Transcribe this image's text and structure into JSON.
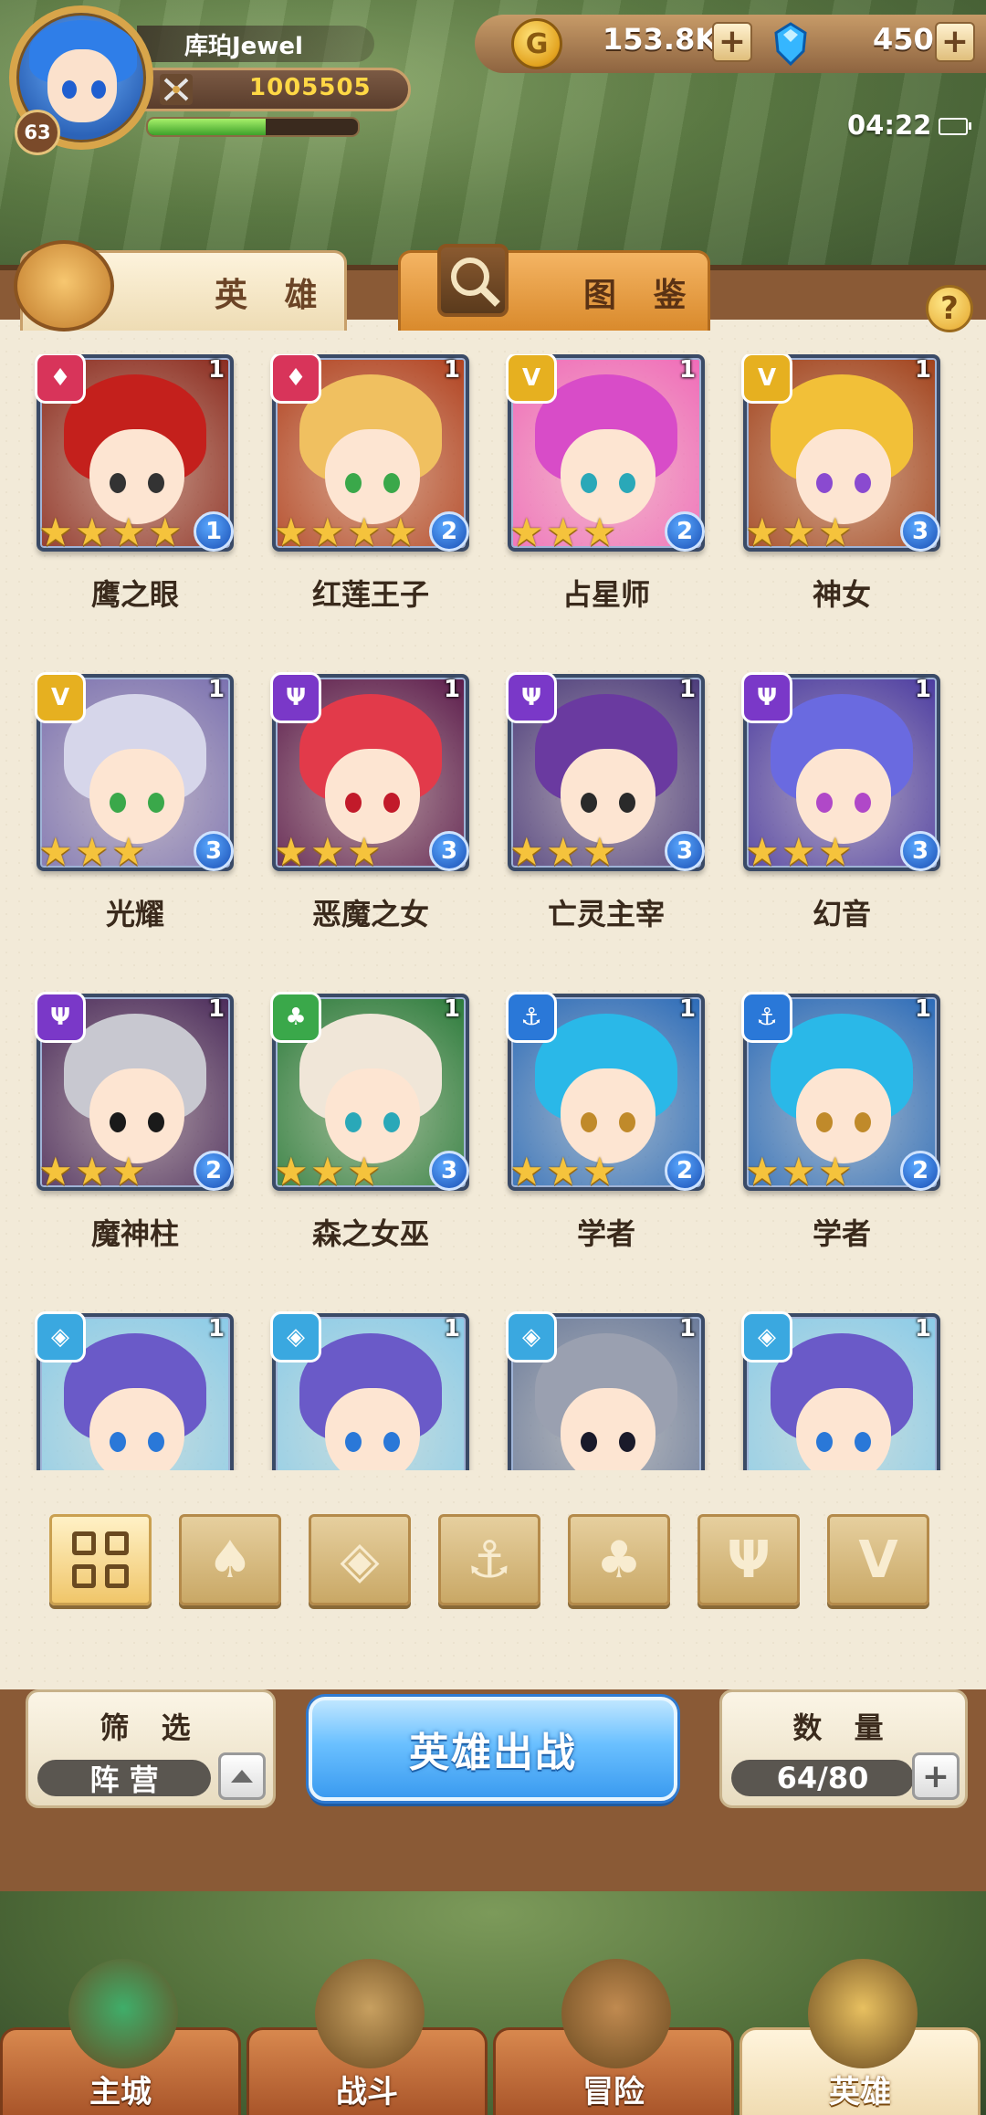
{
  "player": {
    "name": "库珀Jewel",
    "level": "63",
    "power": "1005505",
    "exp_fraction": 0.56
  },
  "resources": {
    "gold": "153.8K",
    "gems": "450",
    "add_symbol": "+"
  },
  "status": {
    "time": "04:22"
  },
  "tabs": {
    "heroes": "英 雄",
    "codex": "图 鉴",
    "help": "?"
  },
  "heroes": [
    {
      "name": "鹰之眼",
      "stars": 4,
      "level": "1",
      "corner": "1",
      "faction": "fire",
      "faction_color": "#d8345a",
      "hair": "#c4201c",
      "eye": "#333333",
      "bg": "#8a2a1e"
    },
    {
      "name": "红莲王子",
      "stars": 4,
      "level": "2",
      "corner": "1",
      "faction": "fire",
      "faction_color": "#d8345a",
      "hair": "#f0c060",
      "eye": "#3aa84a",
      "bg": "#b0401e"
    },
    {
      "name": "占星师",
      "stars": 3,
      "level": "2",
      "corner": "1",
      "faction": "light",
      "faction_color": "#e6b020",
      "hair": "#d84cc8",
      "eye": "#2aa8b8",
      "bg": "#f06ab8"
    },
    {
      "name": "神女",
      "stars": 3,
      "level": "3",
      "corner": "1",
      "faction": "light",
      "faction_color": "#e6b020",
      "hair": "#f2c038",
      "eye": "#8a4ad0",
      "bg": "#a0401a"
    },
    {
      "name": "光耀",
      "stars": 3,
      "level": "3",
      "corner": "1",
      "faction": "light",
      "faction_color": "#e6b020",
      "hair": "#d6d6ea",
      "eye": "#3aa84a",
      "bg": "#7a70b0"
    },
    {
      "name": "恶魔之女",
      "stars": 3,
      "level": "3",
      "corner": "1",
      "faction": "dark",
      "faction_color": "#7a38c8",
      "hair": "#e23a4a",
      "eye": "#c21a2a",
      "bg": "#5a1a4a"
    },
    {
      "name": "亡灵主宰",
      "stars": 3,
      "level": "3",
      "corner": "1",
      "faction": "dark",
      "faction_color": "#7a38c8",
      "hair": "#6a3aa0",
      "eye": "#2a2a2a",
      "bg": "#4a3a7a"
    },
    {
      "name": "幻音",
      "stars": 3,
      "level": "3",
      "corner": "1",
      "faction": "dark",
      "faction_color": "#7a38c8",
      "hair": "#6a6ae0",
      "eye": "#b048c8",
      "bg": "#4a3aa0"
    },
    {
      "name": "魔神柱",
      "stars": 3,
      "level": "2",
      "corner": "1",
      "faction": "dark",
      "faction_color": "#7a38c8",
      "hair": "#c8c8d0",
      "eye": "#1a1a1a",
      "bg": "#4a2a5a"
    },
    {
      "name": "森之女巫",
      "stars": 3,
      "level": "3",
      "corner": "1",
      "faction": "nature",
      "faction_color": "#3aa84a",
      "hair": "#f0e6d8",
      "eye": "#2aa8b8",
      "bg": "#2a7a3a"
    },
    {
      "name": "学者",
      "stars": 3,
      "level": "2",
      "corner": "1",
      "faction": "water",
      "faction_color": "#2a78d8",
      "hair": "#2ab8e8",
      "eye": "#c08a2a",
      "bg": "#2a6ab8"
    },
    {
      "name": "学者",
      "stars": 3,
      "level": "2",
      "corner": "1",
      "faction": "water",
      "faction_color": "#2a78d8",
      "hair": "#2ab8e8",
      "eye": "#c08a2a",
      "bg": "#2a6ab8"
    },
    {
      "name": "",
      "stars": 0,
      "level": "",
      "corner": "1",
      "faction": "shield",
      "faction_color": "#3aa8e0",
      "hair": "#6a5ac8",
      "eye": "#2a78d8",
      "bg": "#8acbe8"
    },
    {
      "name": "",
      "stars": 0,
      "level": "",
      "corner": "1",
      "faction": "shield",
      "faction_color": "#3aa8e0",
      "hair": "#6a5ac8",
      "eye": "#2a78d8",
      "bg": "#8acbe8"
    },
    {
      "name": "",
      "stars": 0,
      "level": "",
      "corner": "1",
      "faction": "shield",
      "faction_color": "#3aa8e0",
      "hair": "#9aa0b0",
      "eye": "#1a1a2a",
      "bg": "#6a7a9a"
    },
    {
      "name": "",
      "stars": 0,
      "level": "",
      "corner": "1",
      "faction": "shield",
      "faction_color": "#3aa8e0",
      "hair": "#6a5ac8",
      "eye": "#2a78d8",
      "bg": "#8acbe8"
    }
  ],
  "filters": [
    {
      "id": "all",
      "icon": "grid-icon",
      "active": true
    },
    {
      "id": "fire",
      "icon": "flame-icon",
      "active": false
    },
    {
      "id": "shield",
      "icon": "shield-icon",
      "active": false
    },
    {
      "id": "water",
      "icon": "anchor-icon",
      "active": false
    },
    {
      "id": "nature",
      "icon": "beast-icon",
      "active": false
    },
    {
      "id": "dark",
      "icon": "horns-icon",
      "active": false
    },
    {
      "id": "light",
      "icon": "wings-icon",
      "active": false
    }
  ],
  "controls": {
    "filter_label": "筛 选",
    "filter_value": "阵 营",
    "deploy_label": "英雄出战",
    "count_label": "数 量",
    "count_value": "64/80"
  },
  "nav": [
    {
      "label": "主城",
      "active": false
    },
    {
      "label": "战斗",
      "active": false
    },
    {
      "label": "冒险",
      "active": false
    },
    {
      "label": "英雄",
      "active": true
    }
  ],
  "colors": {
    "accent_blue": "#3b9bf0",
    "gold_text": "#ffd845",
    "star": "#f5c33c"
  }
}
